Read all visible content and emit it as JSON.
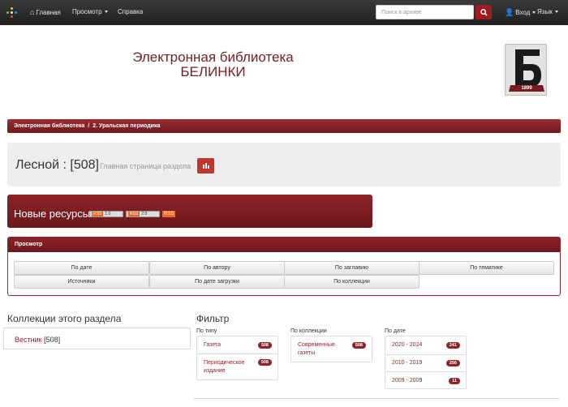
{
  "navbar": {
    "home": "Главная",
    "browse": "Просмотр",
    "help": "Справка",
    "login": "Вход",
    "language": "Язык",
    "search_placeholder": "Поиск в архиве"
  },
  "library": {
    "title_line1": "Электронная библиотека",
    "title_line2": "БЕЛИНКИ",
    "logo_year": "1899"
  },
  "breadcrumb": {
    "root": "Электронная библиотека",
    "separator": "/",
    "current": "2. Уральская периодика"
  },
  "collection": {
    "title": "Лесной : [508]",
    "subtitle": "Главная страница раздела"
  },
  "new_resources": {
    "title": "Новые ресурсы",
    "feeds": [
      {
        "tag": "RSS",
        "label": "1.0"
      },
      {
        "tag": "RSS",
        "label": "2.0"
      }
    ],
    "rss": "RSS"
  },
  "browse": {
    "header": "Просмотр",
    "buttons": [
      "По дате",
      "По автору",
      "По заглавию",
      "По тематике",
      "Источники",
      "По дате загрузки",
      "По коллекции"
    ]
  },
  "collections": {
    "title": "Коллекции этого раздела",
    "items": [
      {
        "name": "Вестник",
        "count": "[508]"
      }
    ]
  },
  "filter": {
    "title": "Фильтр",
    "groups": [
      {
        "label": "По типу",
        "items": [
          {
            "name": "Газета",
            "count": "508"
          },
          {
            "name": "Периодическое издание",
            "count": "508"
          }
        ]
      },
      {
        "label": "По коллекции",
        "items": [
          {
            "name": "Современные газеты",
            "count": "508"
          }
        ]
      },
      {
        "label": "По дате",
        "items": [
          {
            "name": "2020 - 2024",
            "count": "241"
          },
          {
            "name": "2010 - 2019",
            "count": "256"
          },
          {
            "name": "2009 - 2009",
            "count": "11"
          }
        ]
      }
    ]
  },
  "colors": {
    "accent": "#8e2329",
    "navbar": "#2b2b2b",
    "search_button": "#9c1c22"
  },
  "icons": [
    "logo-dots-icon",
    "home-icon",
    "search-icon",
    "user-icon",
    "chart-icon"
  ]
}
